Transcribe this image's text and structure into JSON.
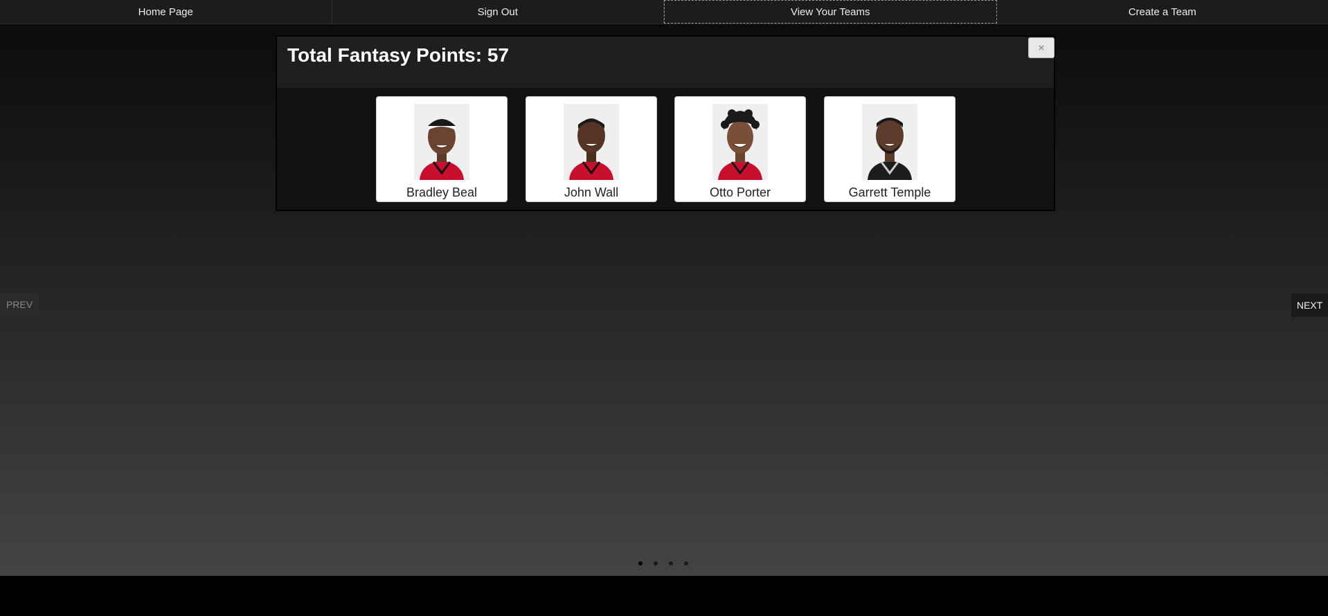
{
  "nav": {
    "items": [
      {
        "label": "Home Page"
      },
      {
        "label": "Sign Out"
      },
      {
        "label": "View Your Teams"
      },
      {
        "label": "Create a Team"
      }
    ]
  },
  "modal": {
    "title": "Total Fantasy Points: 57",
    "close_label": "×",
    "players": [
      {
        "name": "Bradley Beal",
        "jersey_color": "#c8102e"
      },
      {
        "name": "John Wall",
        "jersey_color": "#c8102e"
      },
      {
        "name": "Otto Porter",
        "jersey_color": "#c8102e"
      },
      {
        "name": "Garrett Temple",
        "jersey_color": "#1d1d1d"
      }
    ]
  },
  "carousel": {
    "prev_label": "PREV",
    "next_label": "NEXT",
    "slide_count": 4,
    "active_slide": 1
  }
}
